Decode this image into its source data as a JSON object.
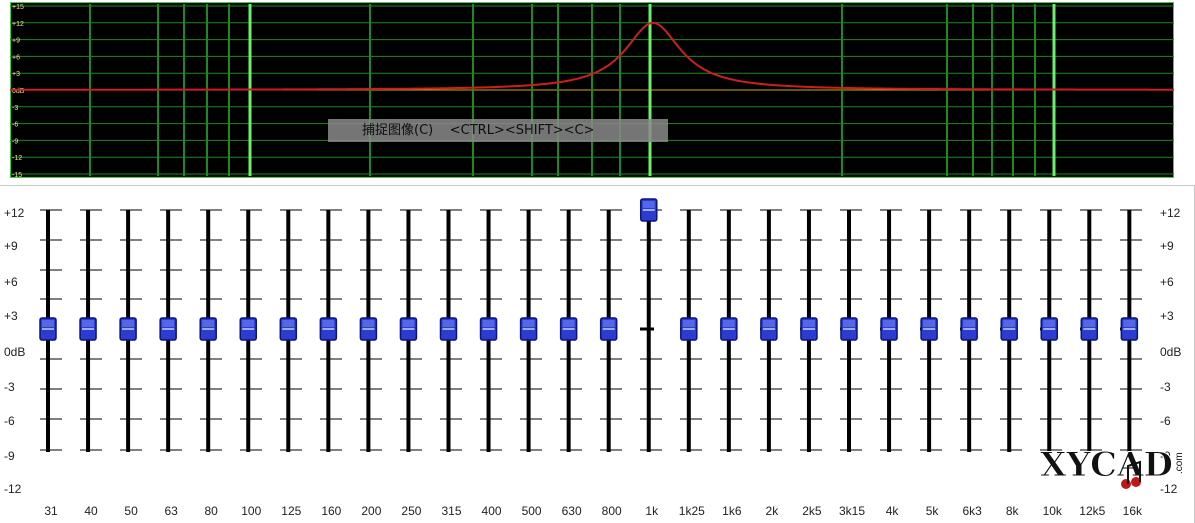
{
  "curve_chart": {
    "y_labels": [
      "+15",
      "+12",
      "+9",
      "+6",
      "+3",
      "0dB",
      "-3",
      "-6",
      "-9",
      "-12",
      "-15"
    ],
    "y_range": [
      -15,
      15
    ],
    "colors": {
      "background": "#000000",
      "grid": "#1e8a1e",
      "border": "#3dd23d",
      "curve": "#cc1f1f",
      "zero_line": "#d4aa00"
    }
  },
  "tooltip": {
    "text": "捕捉图像(C)    <CTRL><SHIFT><C>"
  },
  "scale_left": [
    "+12",
    "+9",
    "+6",
    "+3",
    "0dB",
    "-3",
    "-6",
    "-9",
    "-12"
  ],
  "scale_right": [
    "+12",
    "+9",
    "+6",
    "+3",
    "0dB",
    "-3",
    "-6",
    "-9",
    "-12"
  ],
  "bands": [
    {
      "label": "31",
      "gain": 0
    },
    {
      "label": "40",
      "gain": 0
    },
    {
      "label": "50",
      "gain": 0
    },
    {
      "label": "63",
      "gain": 0
    },
    {
      "label": "80",
      "gain": 0
    },
    {
      "label": "100",
      "gain": 0
    },
    {
      "label": "125",
      "gain": 0
    },
    {
      "label": "160",
      "gain": 0
    },
    {
      "label": "200",
      "gain": 0
    },
    {
      "label": "250",
      "gain": 0
    },
    {
      "label": "315",
      "gain": 0
    },
    {
      "label": "400",
      "gain": 0
    },
    {
      "label": "500",
      "gain": 0
    },
    {
      "label": "630",
      "gain": 0
    },
    {
      "label": "800",
      "gain": 0
    },
    {
      "label": "1k",
      "gain": 12
    },
    {
      "label": "1k25",
      "gain": 0
    },
    {
      "label": "1k6",
      "gain": 0
    },
    {
      "label": "2k",
      "gain": 0
    },
    {
      "label": "2k5",
      "gain": 0
    },
    {
      "label": "3k15",
      "gain": 0
    },
    {
      "label": "4k",
      "gain": 0
    },
    {
      "label": "5k",
      "gain": 0
    },
    {
      "label": "6k3",
      "gain": 0
    },
    {
      "label": "8k",
      "gain": 0
    },
    {
      "label": "10k",
      "gain": 0
    },
    {
      "label": "12k5",
      "gain": 0
    },
    {
      "label": "16k",
      "gain": 0
    }
  ],
  "logo": {
    "text": "XYCAD",
    "suffix": ".com"
  },
  "colors": {
    "slider_knob": "#2b3ccf",
    "slider_knob_edge": "#0a147a",
    "track": "#000000"
  }
}
